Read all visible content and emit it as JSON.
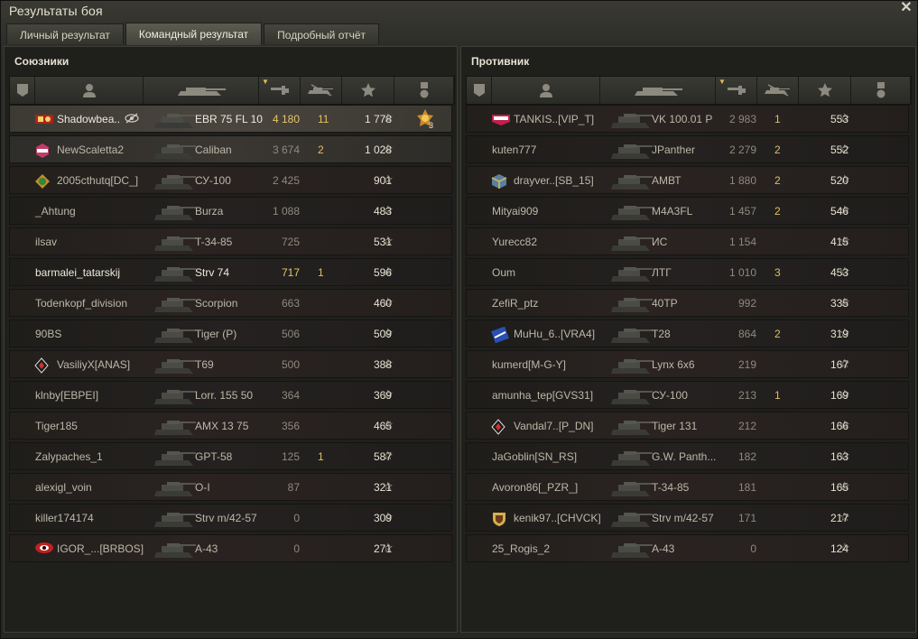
{
  "window": {
    "title": "Результаты боя",
    "close_icon": "close-icon"
  },
  "tabs": [
    {
      "label": "Личный результат"
    },
    {
      "label": "Командный результат"
    },
    {
      "label": "Подробный отчёт"
    }
  ],
  "allies": {
    "title": "Союзники",
    "rows": [
      {
        "name": "Shadowbea..",
        "vehicle": "EBR 75 FL 10",
        "damage": "4 180",
        "frags": "11",
        "xp": "1 778",
        "badge": "rank-badge-red",
        "hidden_icon": "eye-crossed-icon",
        "medal": "3"
      },
      {
        "name": "NewScaletta2",
        "vehicle": "Caliban",
        "damage": "3 674",
        "frags": "2",
        "xp": "1 028",
        "badge": "clan-badge-love"
      },
      {
        "name": "2005cthutq[DC_]",
        "vehicle": "СУ-100",
        "damage": "2 425",
        "frags": "",
        "xp": "901",
        "badge": "clan-badge-green"
      },
      {
        "name": "_Ahtung",
        "vehicle": "Burza",
        "damage": "1 088",
        "frags": "",
        "xp": "483"
      },
      {
        "name": "ilsav",
        "vehicle": "T-34-85",
        "damage": "725",
        "frags": "",
        "xp": "531"
      },
      {
        "name": "barmalei_tatarskij",
        "vehicle": "Strv 74",
        "damage": "717",
        "frags": "1",
        "xp": "596"
      },
      {
        "name": "Todenkopf_division",
        "vehicle": "Scorpion",
        "damage": "663",
        "frags": "",
        "xp": "460"
      },
      {
        "name": "90BS",
        "vehicle": "Tiger (P)",
        "damage": "506",
        "frags": "",
        "xp": "509"
      },
      {
        "name": "VasiliyX[ANAS]",
        "vehicle": "T69",
        "damage": "500",
        "frags": "",
        "xp": "388",
        "badge": "clan-badge-diamond"
      },
      {
        "name": "klnby[EBPEI]",
        "vehicle": "Lorr. 155 50",
        "damage": "364",
        "frags": "",
        "xp": "369"
      },
      {
        "name": "Tiger185",
        "vehicle": "AMX 13 75",
        "damage": "356",
        "frags": "",
        "xp": "465"
      },
      {
        "name": "Zalypaches_1",
        "vehicle": "GPT-58",
        "damage": "125",
        "frags": "1",
        "xp": "587"
      },
      {
        "name": "alexigl_voin",
        "vehicle": "О-I",
        "damage": "87",
        "frags": "",
        "xp": "321"
      },
      {
        "name": "killer174174",
        "vehicle": "Strv m/42-57",
        "damage": "0",
        "frags": "",
        "xp": "309"
      },
      {
        "name": "IGOR_...[BRBOS]",
        "vehicle": "А-43",
        "damage": "0",
        "frags": "",
        "xp": "271",
        "badge": "clan-badge-red-eye"
      }
    ]
  },
  "enemies": {
    "title": "Противник",
    "rows": [
      {
        "name": "TANKIS..[VIP_T]",
        "vehicle": "VK 100.01 P",
        "damage": "2 983",
        "frags": "1",
        "xp": "553",
        "badge": "clan-badge-lbwa"
      },
      {
        "name": "kuten777",
        "vehicle": "JPanther",
        "damage": "2 279",
        "frags": "2",
        "xp": "552"
      },
      {
        "name": "drayver..[SB_15]",
        "vehicle": "АМВТ",
        "damage": "1 880",
        "frags": "2",
        "xp": "520",
        "badge": "clan-badge-cube"
      },
      {
        "name": "Mityai909",
        "vehicle": "M4A3FL",
        "damage": "1 457",
        "frags": "2",
        "xp": "546"
      },
      {
        "name": "Yurecc82",
        "vehicle": "ИС",
        "damage": "1 154",
        "frags": "",
        "xp": "415"
      },
      {
        "name": "Oum",
        "vehicle": "ЛТГ",
        "damage": "1 010",
        "frags": "3",
        "xp": "453"
      },
      {
        "name": "ZefiR_ptz",
        "vehicle": "40TP",
        "damage": "992",
        "frags": "",
        "xp": "335"
      },
      {
        "name": "MuHu_6..[VRA4]",
        "vehicle": "T28",
        "damage": "864",
        "frags": "2",
        "xp": "319",
        "badge": "clan-badge-blue"
      },
      {
        "name": "kumerd[M-G-Y]",
        "vehicle": "Lynx 6x6",
        "damage": "219",
        "frags": "",
        "xp": "167"
      },
      {
        "name": "amunha_tep[GVS31]",
        "vehicle": "СУ-100",
        "damage": "213",
        "frags": "1",
        "xp": "169"
      },
      {
        "name": "Vandal7..[P_DN]",
        "vehicle": "Tiger 131",
        "damage": "212",
        "frags": "",
        "xp": "166",
        "badge": "clan-badge-diamond"
      },
      {
        "name": "JaGoblin[SN_RS]",
        "vehicle": "G.W. Panth...",
        "damage": "182",
        "frags": "",
        "xp": "163"
      },
      {
        "name": "Avoron86[_PZR_]",
        "vehicle": "T-34-85",
        "damage": "181",
        "frags": "",
        "xp": "165"
      },
      {
        "name": "kenik97..[CHVCK]",
        "vehicle": "Strv m/42-57",
        "damage": "171",
        "frags": "",
        "xp": "217",
        "badge": "clan-badge-shield"
      },
      {
        "name": "25_Rogis_2",
        "vehicle": "А-43",
        "damage": "0",
        "frags": "",
        "xp": "124"
      }
    ]
  },
  "header_icons": [
    "squad-icon",
    "player-icon",
    "tank-icon",
    "damage-icon",
    "frags-icon",
    "xp-star-icon",
    "medal-icon"
  ],
  "colors": {
    "accent": "#e2bf62",
    "text": "#c8c4b5",
    "panel": "#1f1f1c"
  }
}
